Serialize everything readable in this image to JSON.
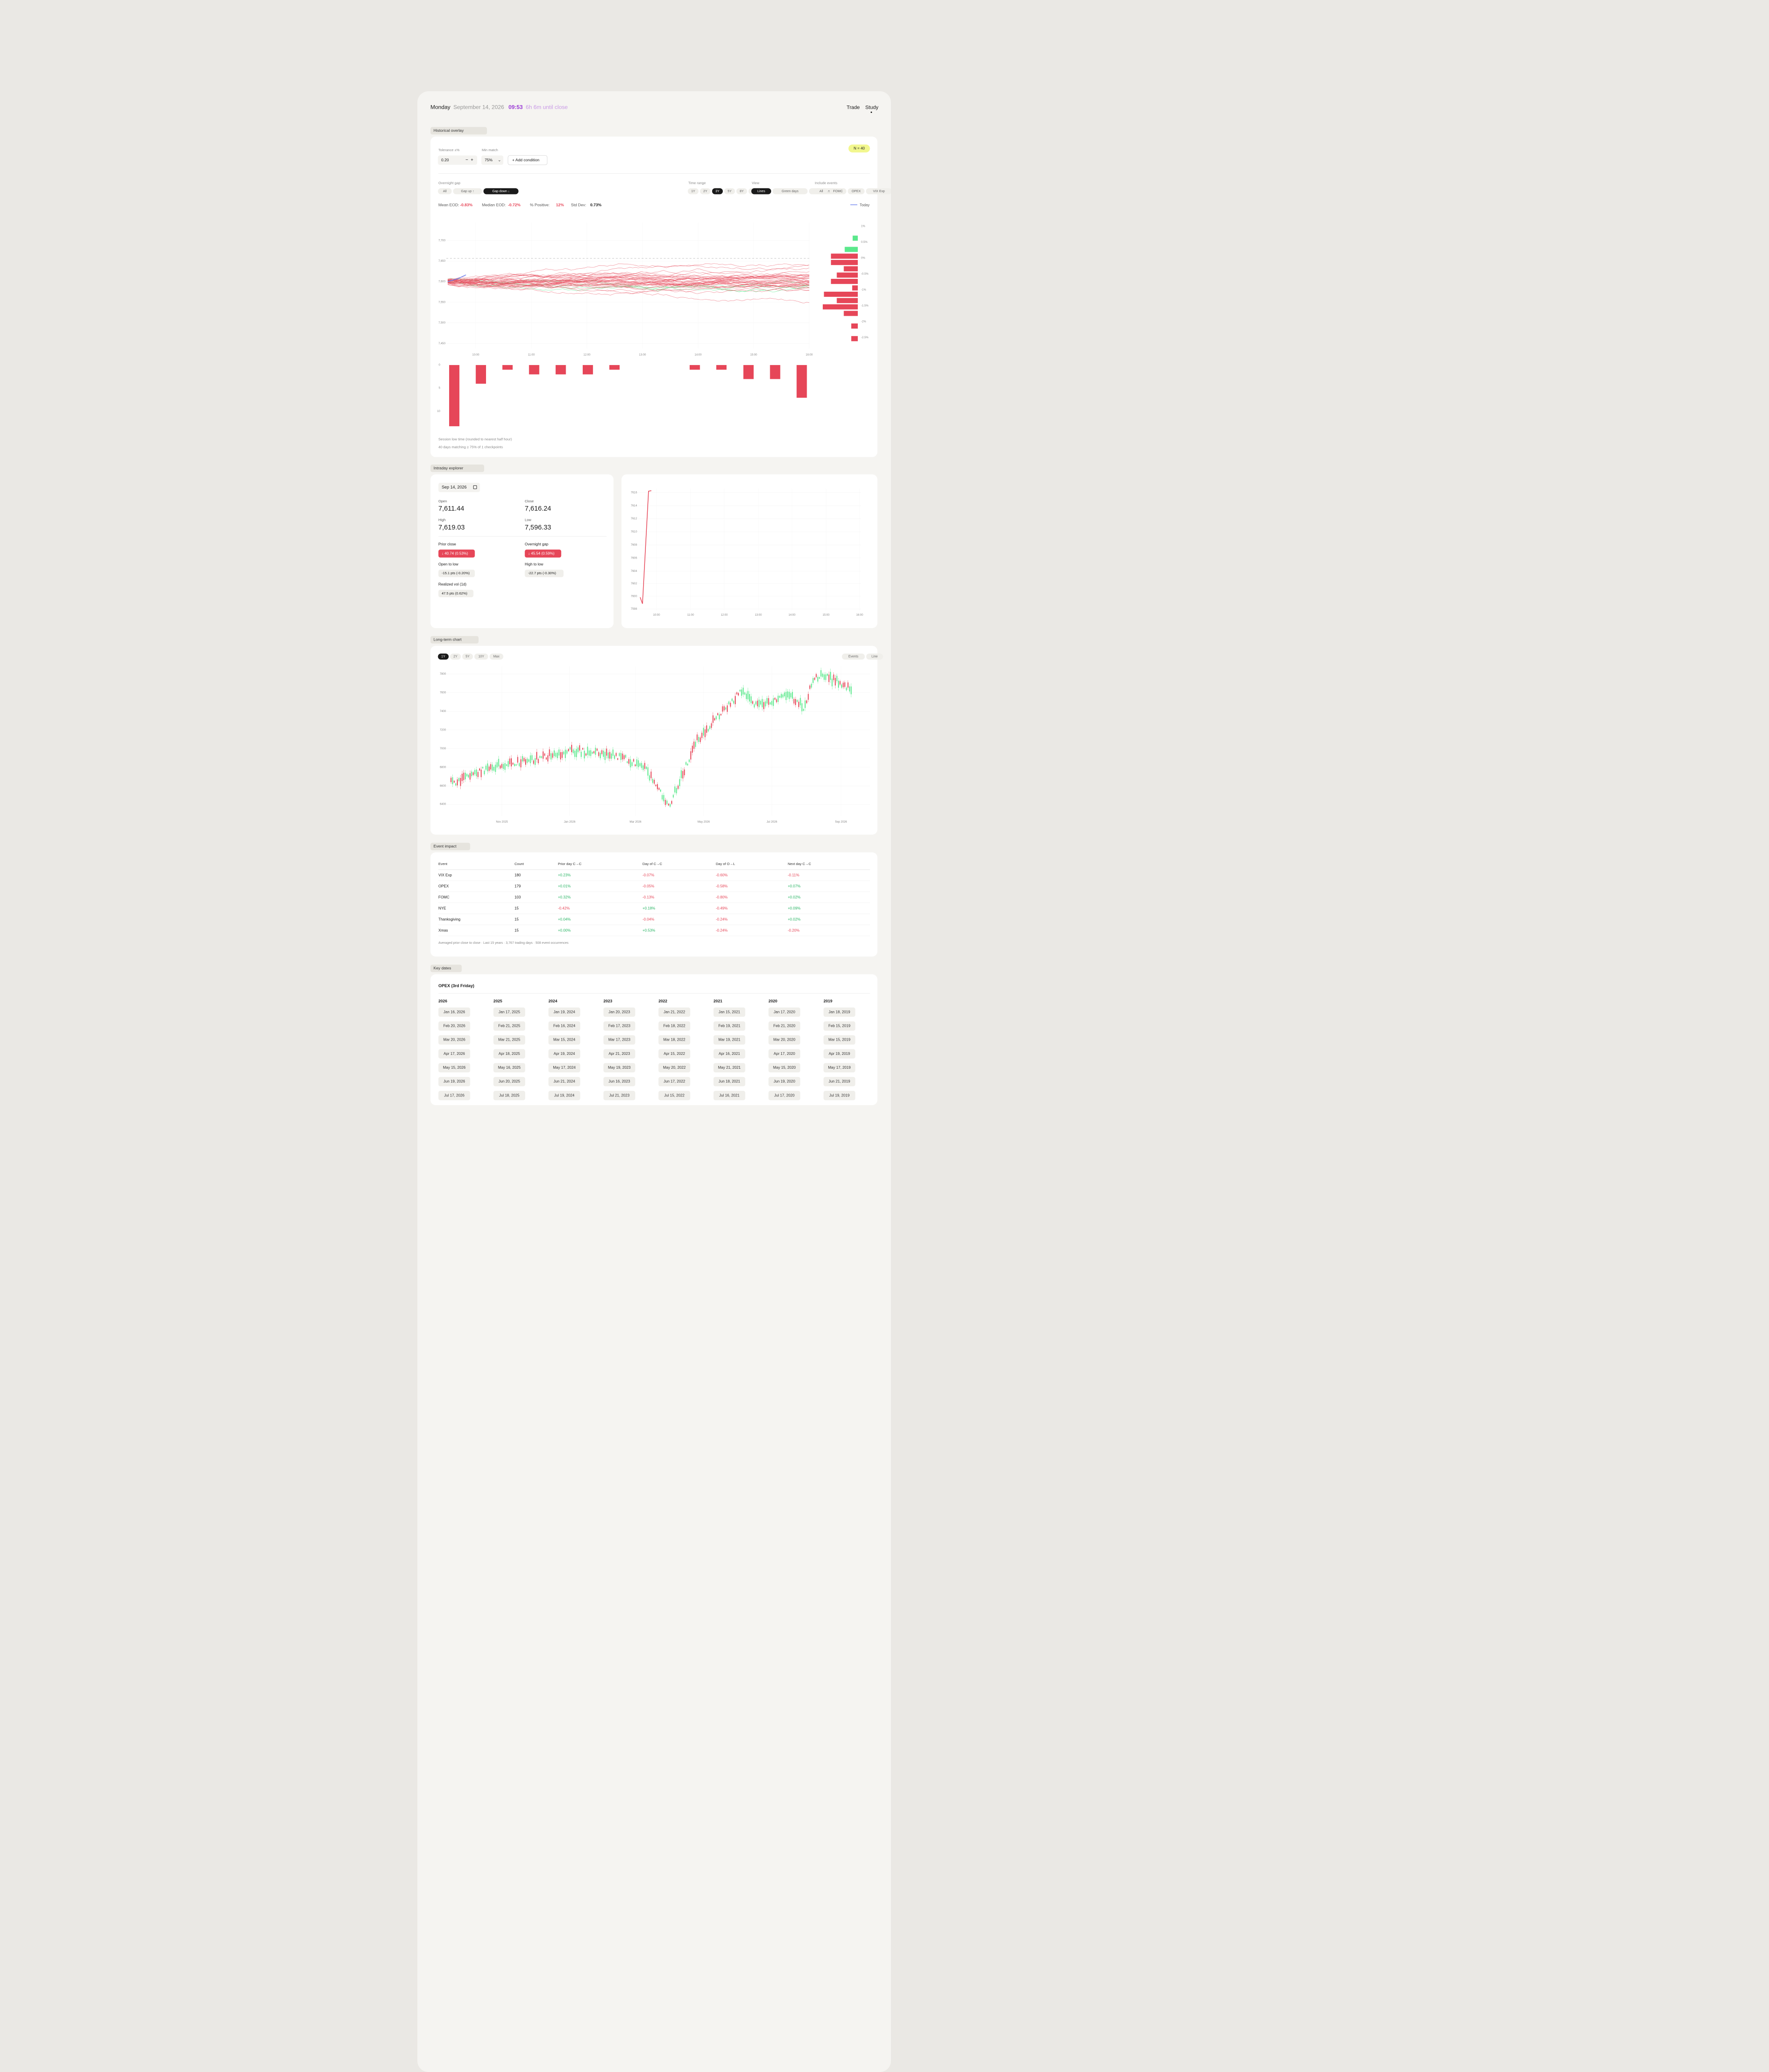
{
  "header": {
    "day": "Monday",
    "date": "September 14, 2026",
    "time": "09:53",
    "until_close": "6h 6m until close",
    "nav": [
      "Trade",
      "Study"
    ],
    "active_nav": "Study"
  },
  "historical": {
    "section_title": "Historical overlay",
    "tolerance_label": "Tolerance ±%",
    "tolerance_value": "0.20",
    "min_match_label": "Min match",
    "min_match_value": "75%",
    "add_condition": "+ Add condition",
    "n_badge": "N = 40",
    "gap_label": "Overnight gap",
    "gap_options": [
      "All",
      "Gap up ↑",
      "Gap down ↓"
    ],
    "gap_active": "Gap down ↓",
    "range_label": "Time range",
    "range_options": [
      "1Y",
      "2Y",
      "3Y",
      "5Y",
      "8Y",
      "All"
    ],
    "range_active": "3Y",
    "view_label": "View",
    "view_options": [
      "Lines",
      "Green days",
      "Red days"
    ],
    "view_active": "Lines",
    "events_label": "Include events",
    "events_options": [
      "All",
      "FOMC",
      "OPEX",
      "VIX Exp"
    ],
    "stats": {
      "mean_label": "Mean EOD:",
      "mean": "-0.83%",
      "median_label": "Median EOD:",
      "median": "-0.72%",
      "pos_label": "% Positive:",
      "pos": "12%",
      "std_label": "Std Dev:",
      "std": "0.73%"
    },
    "legend_today": "Today",
    "y_ticks": [
      "7,700",
      "7,650",
      "7,600",
      "7,550",
      "7,500",
      "7,450"
    ],
    "pct_ticks": [
      "1%",
      "0.5%",
      "0%",
      "-0.5%",
      "-1%",
      "-1.5%",
      "-2%",
      "-2.5%"
    ],
    "x_ticks": [
      "10:00",
      "11:00",
      "12:00",
      "13:00",
      "14:00",
      "15:00",
      "16:00"
    ],
    "low_ticks": [
      "0",
      "5",
      "10"
    ],
    "caption1": "Session low time (rounded to nearest half hour)",
    "caption2": "40 days matching ≥ 75% of 1 checkpoints"
  },
  "intraday": {
    "section_title": "Intraday explorer",
    "date": "Sep 14, 2026",
    "open_label": "Open",
    "open": "7,611.44",
    "close_label": "Close",
    "close": "7,616.24",
    "high_label": "High",
    "high": "7,619.03",
    "low_label": "Low",
    "low": "7,596.33",
    "prior_close_label": "Prior close",
    "prior_close": "↓ 40.74 (0.53%)",
    "gap_label": "Overnight gap",
    "gap": "↓ 45.54 (0.59%)",
    "open_low_label": "Open to low",
    "open_low": "-15.1 pts (-0.20%)",
    "high_low_label": "High to low",
    "high_low": "-22.7 pts (-0.30%)",
    "rvol_label": "Realized vol (1d)",
    "rvol": "47.5 pts (0.62%)",
    "y_ticks": [
      "7616",
      "7614",
      "7612",
      "7610",
      "7608",
      "7606",
      "7604",
      "7602",
      "7600",
      "7598"
    ],
    "x_ticks": [
      "10:00",
      "11:00",
      "12:00",
      "13:00",
      "14:00",
      "15:00",
      "16:00"
    ]
  },
  "longterm": {
    "section_title": "Long-term chart",
    "ranges": [
      "1Y",
      "2Y",
      "5Y",
      "10Y",
      "Max"
    ],
    "range_active": "1Y",
    "toggles": [
      "Events",
      "Line"
    ],
    "y_ticks": [
      "7800",
      "7600",
      "7400",
      "7200",
      "7000",
      "6800",
      "6600",
      "6400"
    ],
    "x_ticks": [
      "Nov 2025",
      "Jan 2026",
      "Mar 2026",
      "May 2026",
      "Jul 2026",
      "Sep 2026"
    ]
  },
  "events": {
    "section_title": "Event impact",
    "columns": [
      "Event",
      "Count",
      "Prior day C→C",
      "Day of C→C",
      "Day of O→L",
      "Next day C→C"
    ],
    "rows": [
      [
        "VIX Exp",
        "180",
        "+0.23%",
        "-0.07%",
        "-0.60%",
        "-0.11%"
      ],
      [
        "OPEX",
        "179",
        "+0.01%",
        "-0.05%",
        "-0.58%",
        "+0.07%"
      ],
      [
        "FOMC",
        "103",
        "+0.32%",
        "-0.13%",
        "-0.80%",
        "+0.02%"
      ],
      [
        "NYE",
        "15",
        "-0.42%",
        "+0.18%",
        "-0.49%",
        "+0.09%"
      ],
      [
        "Thanksgiving",
        "15",
        "+0.04%",
        "-0.04%",
        "-0.24%",
        "+0.02%"
      ],
      [
        "Xmas",
        "15",
        "+0.00%",
        "+0.53%",
        "-0.24%",
        "-0.20%"
      ]
    ],
    "footnote": "Averaged prior close to close · Last 15 years · 3,767 trading days · 508 event occurrences"
  },
  "keydates": {
    "section_title": "Key dates",
    "subtitle": "OPEX (3rd Friday)",
    "years": [
      "2026",
      "2025",
      "2024",
      "2023",
      "2022",
      "2021",
      "2020",
      "2019"
    ],
    "dates": [
      [
        "Jan 16, 2026",
        "Feb 20, 2026",
        "Mar 20, 2026",
        "Apr 17, 2026",
        "May 15, 2026",
        "Jun 19, 2026",
        "Jul 17, 2026"
      ],
      [
        "Jan 17, 2025",
        "Feb 21, 2025",
        "Mar 21, 2025",
        "Apr 18, 2025",
        "May 16, 2025",
        "Jun 20, 2025",
        "Jul 18, 2025"
      ],
      [
        "Jan 19, 2024",
        "Feb 16, 2024",
        "Mar 15, 2024",
        "Apr 19, 2024",
        "May 17, 2024",
        "Jun 21, 2024",
        "Jul 19, 2024"
      ],
      [
        "Jan 20, 2023",
        "Feb 17, 2023",
        "Mar 17, 2023",
        "Apr 21, 2023",
        "May 19, 2023",
        "Jun 16, 2023",
        "Jul 21, 2023"
      ],
      [
        "Jan 21, 2022",
        "Feb 18, 2022",
        "Mar 18, 2022",
        "Apr 15, 2022",
        "May 20, 2022",
        "Jun 17, 2022",
        "Jul 15, 2022"
      ],
      [
        "Jan 15, 2021",
        "Feb 19, 2021",
        "Mar 19, 2021",
        "Apr 16, 2021",
        "May 21, 2021",
        "Jun 18, 2021",
        "Jul 16, 2021"
      ],
      [
        "Jan 17, 2020",
        "Feb 21, 2020",
        "Mar 20, 2020",
        "Apr 17, 2020",
        "May 15, 2020",
        "Jun 19, 2020",
        "Jul 17, 2020"
      ],
      [
        "Jan 18, 2019",
        "Feb 15, 2019",
        "Mar 15, 2019",
        "Apr 19, 2019",
        "May 17, 2019",
        "Jun 21, 2019",
        "Jul 19, 2019"
      ]
    ]
  },
  "colors": {
    "red": "#e64658",
    "green": "#5be88c",
    "accent": "#9b3cd6",
    "accent_light": "#c99ae6"
  }
}
